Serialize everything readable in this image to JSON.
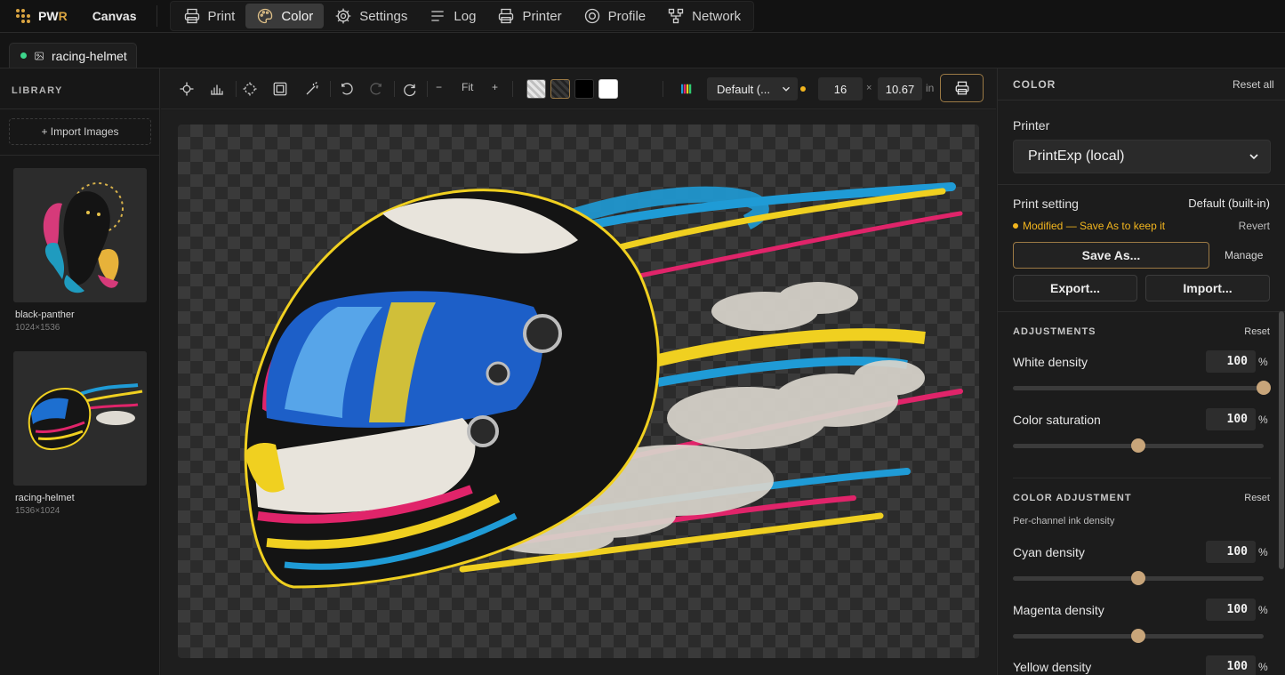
{
  "app": {
    "brand_prefix": "PW",
    "brand_suffix": "R",
    "canvas_label": "Canvas"
  },
  "nav": [
    {
      "label": "Print",
      "icon": "printer-icon",
      "active": false
    },
    {
      "label": "Color",
      "icon": "palette-icon",
      "active": true
    },
    {
      "label": "Settings",
      "icon": "gear-icon",
      "active": false
    },
    {
      "label": "Log",
      "icon": "lines-icon",
      "active": false
    },
    {
      "label": "Printer",
      "icon": "printer-icon",
      "active": false
    },
    {
      "label": "Profile",
      "icon": "target-icon",
      "active": false
    },
    {
      "label": "Network",
      "icon": "network-icon",
      "active": false
    }
  ],
  "doc_tab": {
    "name": "racing-helmet",
    "status_color": "#3dd68c"
  },
  "library": {
    "title": "LIBRARY",
    "import_label": "+ Import Images",
    "items": [
      {
        "name": "black-panther",
        "dims": "1024×1536"
      },
      {
        "name": "racing-helmet",
        "dims": "1536×1024"
      }
    ]
  },
  "toolbar": {
    "zoom_out": "−",
    "zoom_fit": "Fit",
    "zoom_in": "+",
    "profile_select": "Default (...",
    "width": "16",
    "times": "×",
    "height": "10.67",
    "unit": "in",
    "modified_dot_color": "#f2b51e"
  },
  "color_panel": {
    "title": "COLOR",
    "reset_all": "Reset all",
    "printer_label": "Printer",
    "printer_value": "PrintExp (local)",
    "print_setting_label": "Print setting",
    "print_setting_value": "Default (built-in)",
    "modified_notice": "Modified — Save As to keep it",
    "revert": "Revert",
    "save_as": "Save As...",
    "manage": "Manage",
    "export": "Export...",
    "import": "Import...",
    "adjustments": {
      "title": "ADJUSTMENTS",
      "reset": "Reset",
      "sliders": [
        {
          "label": "White density",
          "value": "100",
          "unit": "%",
          "position": 1.0
        },
        {
          "label": "Color saturation",
          "value": "100",
          "unit": "%",
          "position": 0.5
        }
      ]
    },
    "color_adjustment": {
      "title": "COLOR ADJUSTMENT",
      "reset": "Reset",
      "subtitle": "Per-channel ink density",
      "sliders": [
        {
          "label": "Cyan density",
          "value": "100",
          "unit": "%",
          "position": 0.5
        },
        {
          "label": "Magenta density",
          "value": "100",
          "unit": "%",
          "position": 0.5
        },
        {
          "label": "Yellow density",
          "value": "100",
          "unit": "%",
          "position": 0.5
        }
      ]
    }
  },
  "accent_color": "#d9a441"
}
